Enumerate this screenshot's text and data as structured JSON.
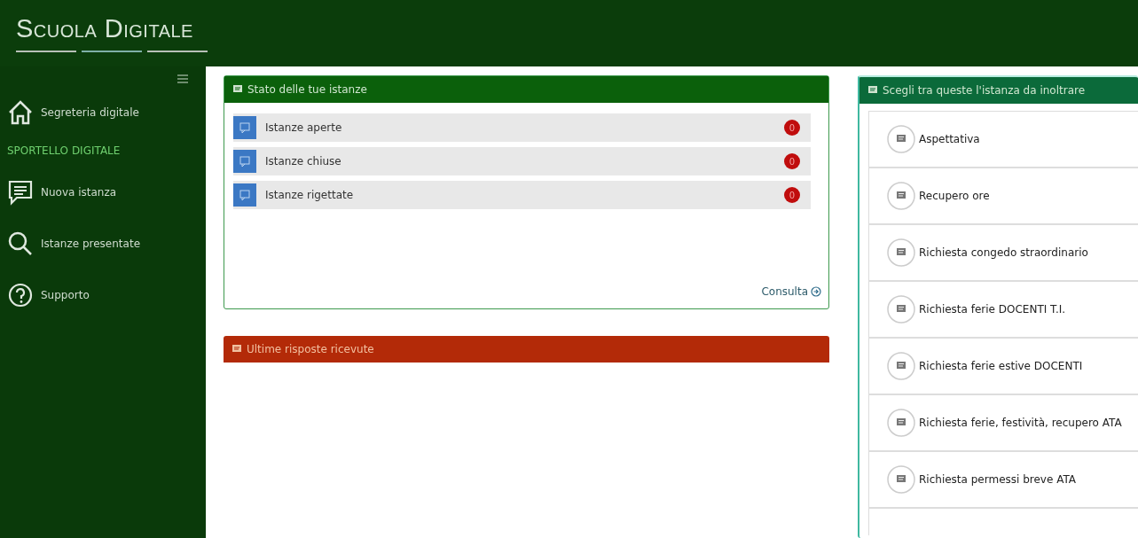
{
  "header": {
    "logo": "Scuola Digitale"
  },
  "sidebar": {
    "items": [
      {
        "kind": "home",
        "label": "Segreteria digitale"
      },
      {
        "kind": "section",
        "label": "SPORTELLO DIGITALE"
      },
      {
        "kind": "compose",
        "label": "Nuova istanza"
      },
      {
        "kind": "search",
        "label": "Istanze presentate"
      },
      {
        "kind": "help",
        "label": "Supporto"
      }
    ]
  },
  "status_panel": {
    "title": "Stato delle tue istanze",
    "rows": [
      {
        "label": "Istanze aperte",
        "count": "0"
      },
      {
        "label": "Istanze chiuse",
        "count": "0"
      },
      {
        "label": "Istanze rigettate",
        "count": "0"
      }
    ],
    "link": "Consulta"
  },
  "replies_panel": {
    "title": "Ultime risposte ricevute"
  },
  "requests_panel": {
    "title": "Scegli tra queste l'istanza da inoltrare",
    "items": [
      "Aspettativa",
      "Recupero ore",
      "Richiesta congedo straordinario",
      "Richiesta ferie DOCENTI T.I.",
      "Richiesta ferie estive DOCENTI",
      "Richiesta ferie, festività, recupero ATA",
      "Richiesta permessi breve ATA"
    ]
  }
}
